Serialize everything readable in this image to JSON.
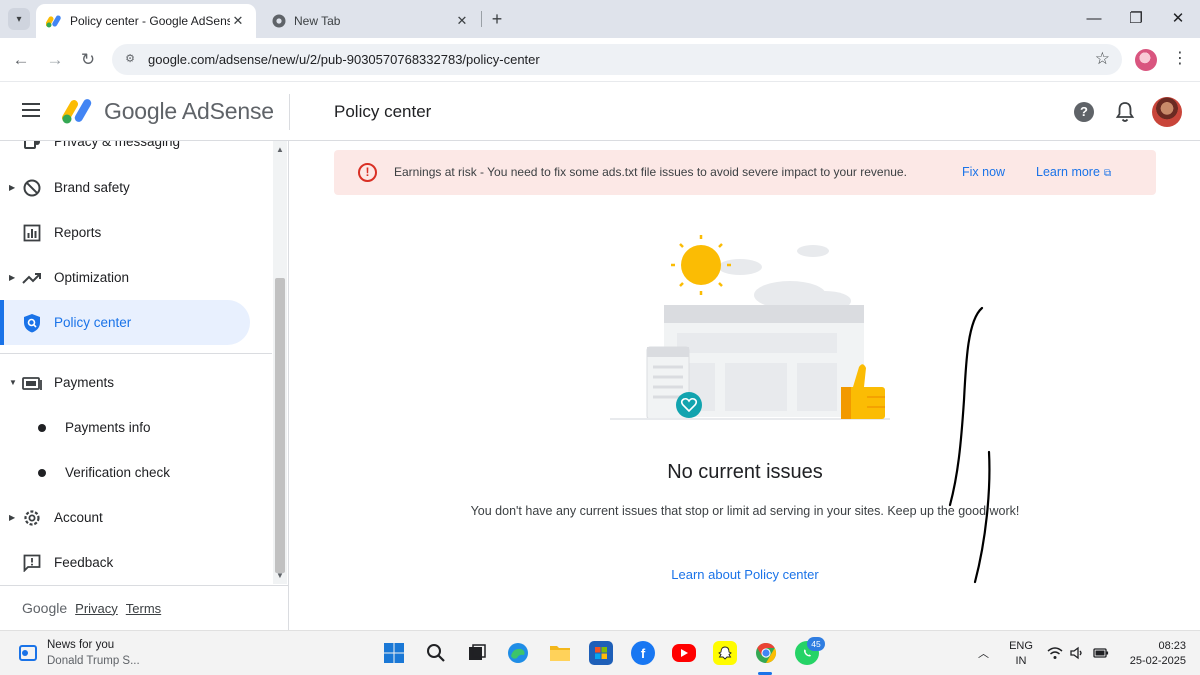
{
  "browser": {
    "tabs": [
      {
        "title": "Policy center - Google AdSense",
        "active": true
      },
      {
        "title": "New Tab",
        "active": false
      }
    ],
    "url": "google.com/adsense/new/u/2/pub-9030570768332783/policy-center"
  },
  "header": {
    "brand": "Google AdSense",
    "page_title": "Policy center"
  },
  "sidebar": {
    "items": [
      {
        "label": "Privacy & messaging"
      },
      {
        "label": "Brand safety"
      },
      {
        "label": "Reports"
      },
      {
        "label": "Optimization"
      },
      {
        "label": "Policy center"
      },
      {
        "label": "Payments"
      },
      {
        "label": "Payments info"
      },
      {
        "label": "Verification check"
      },
      {
        "label": "Account"
      },
      {
        "label": "Feedback"
      }
    ],
    "footer": {
      "google": "Google",
      "privacy": "Privacy",
      "terms": "Terms"
    }
  },
  "alert": {
    "text": "Earnings at risk - You need to fix some ads.txt file issues to avoid severe impact to your revenue.",
    "fix_now": "Fix now",
    "learn_more": "Learn more"
  },
  "main": {
    "empty_title": "No current issues",
    "empty_desc": "You don't have any current issues that stop or limit ad serving in your sites. Keep up the good work!",
    "learn_link": "Learn about Policy center"
  },
  "taskbar": {
    "news_title": "News for you",
    "news_sub": "Donald Trump S...",
    "whatsapp_badge": "45",
    "lang_top": "ENG",
    "lang_bottom": "IN",
    "time": "08:23",
    "date": "25-02-2025"
  },
  "colors": {
    "accent": "#1a73e8",
    "alert_bg": "#fce8e6",
    "alert_red": "#d93025",
    "active_nav_bg": "#e8f0fe"
  }
}
